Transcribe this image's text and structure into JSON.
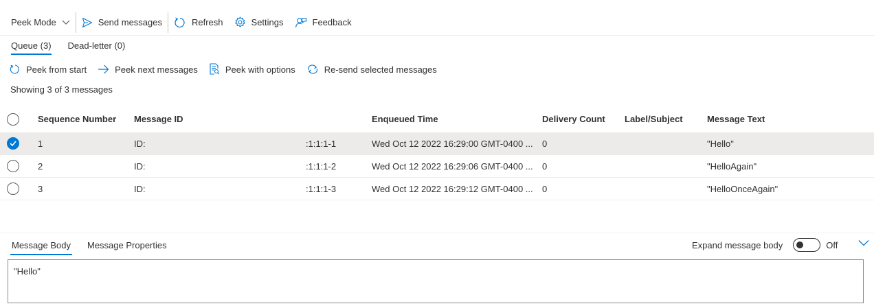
{
  "toolbar": {
    "peek_mode": "Peek Mode",
    "send_messages": "Send messages",
    "refresh": "Refresh",
    "settings": "Settings",
    "feedback": "Feedback"
  },
  "tabs": {
    "queue": "Queue (3)",
    "dead_letter": "Dead-letter (0)"
  },
  "actions": {
    "peek_from_start": "Peek from start",
    "peek_next": "Peek next messages",
    "peek_with_options": "Peek with options",
    "resend": "Re-send selected messages"
  },
  "showing": "Showing 3 of 3 messages",
  "table": {
    "headers": {
      "sequence": "Sequence Number",
      "message_id": "Message ID",
      "enqueued": "Enqueued Time",
      "delivery": "Delivery Count",
      "label": "Label/Subject",
      "text": "Message Text"
    },
    "rows": [
      {
        "seq": "1",
        "id_prefix": "ID:",
        "id_suffix": ":1:1:1-1",
        "time": "Wed Oct 12 2022 16:29:00 GMT-0400 ...",
        "count": "0",
        "label": "",
        "text": "\"Hello\""
      },
      {
        "seq": "2",
        "id_prefix": "ID:",
        "id_suffix": ":1:1:1-2",
        "time": "Wed Oct 12 2022 16:29:06 GMT-0400 ...",
        "count": "0",
        "label": "",
        "text": "\"HelloAgain\""
      },
      {
        "seq": "3",
        "id_prefix": "ID:",
        "id_suffix": ":1:1:1-3",
        "time": "Wed Oct 12 2022 16:29:12 GMT-0400 ...",
        "count": "0",
        "label": "",
        "text": "\"HelloOnceAgain\""
      }
    ]
  },
  "bottom": {
    "tab_body": "Message Body",
    "tab_properties": "Message Properties",
    "expand_label": "Expand message body",
    "toggle_state": "Off",
    "body_text": "\"Hello\""
  },
  "colors": {
    "accent": "#0078d4",
    "selected_row": "#edebe9"
  }
}
